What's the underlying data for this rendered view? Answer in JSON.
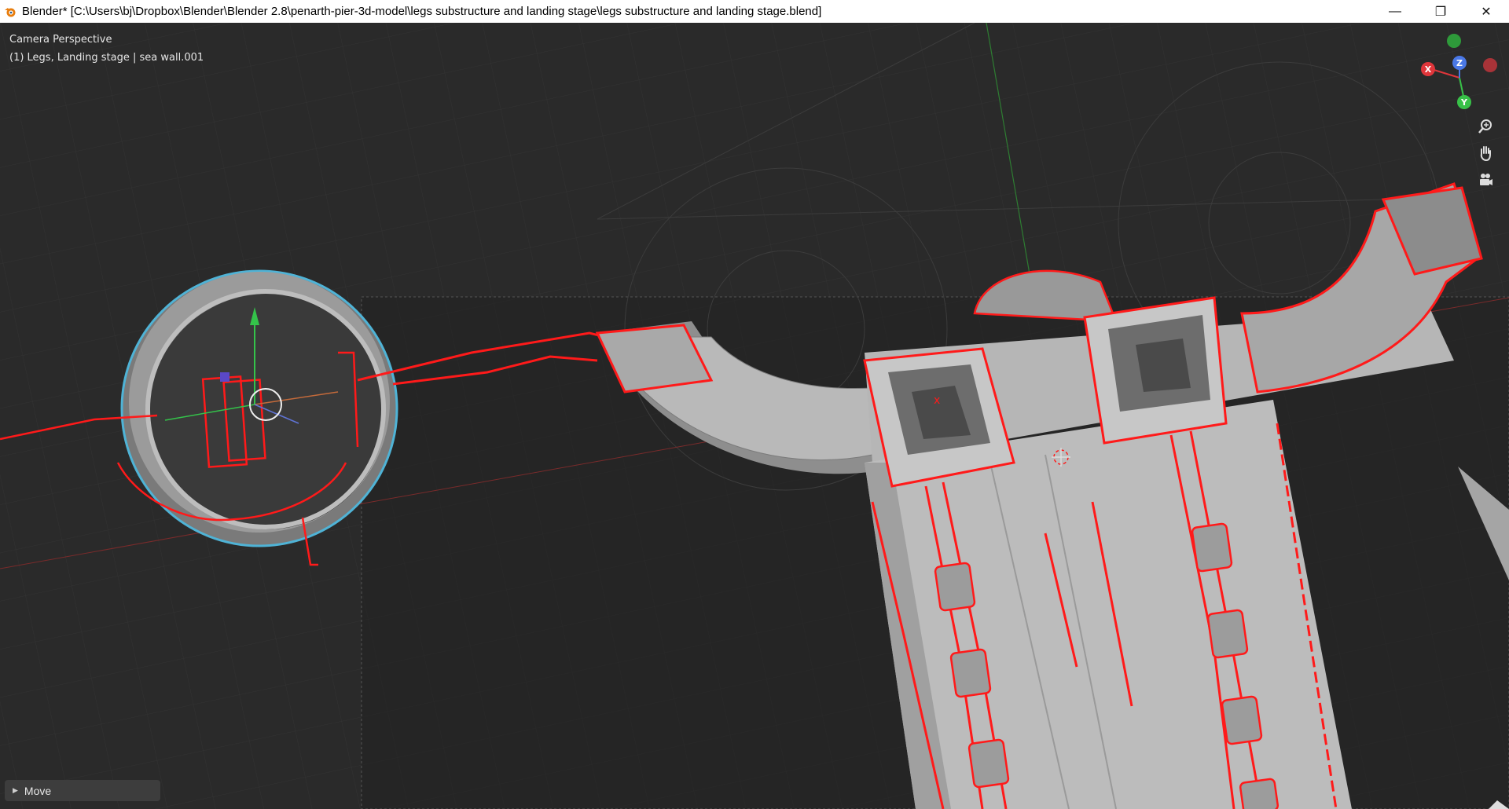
{
  "window": {
    "title": "Blender* [C:\\Users\\bj\\Dropbox\\Blender\\Blender 2.8\\penarth-pier-3d-model\\legs substructure and landing stage\\legs substructure and landing stage.blend]",
    "controls": {
      "minimize": "—",
      "restore": "❐",
      "close": "✕"
    }
  },
  "viewport": {
    "view_name": "Camera Perspective",
    "object_info": "(1) Legs, Landing stage | sea wall.001"
  },
  "gizmo": {
    "x_label": "X",
    "y_label": "Y",
    "z_label": "Z",
    "colors": {
      "x": "#e0363b",
      "y": "#38c148",
      "z": "#4a78e6",
      "neg_x": "#a83338",
      "neg_y": "#2e9a3a"
    },
    "icons": [
      "zoom-icon",
      "pan-hand-icon",
      "camera-icon"
    ]
  },
  "operator_panel": {
    "label": "Move"
  },
  "colors": {
    "annotation_red": "#ff1a1a",
    "mesh_grey": "#b8b8b8",
    "selection_outline": "#4fb3d6"
  }
}
